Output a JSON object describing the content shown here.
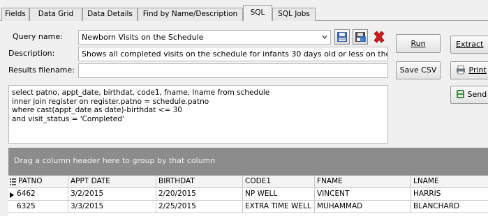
{
  "tabs": [
    {
      "label": "Fields",
      "active": false
    },
    {
      "label": "Data Grid",
      "active": false
    },
    {
      "label": "Data Details",
      "active": false
    },
    {
      "label": "Find by Name/Description",
      "active": false
    },
    {
      "label": "SQL",
      "active": true
    },
    {
      "label": "SQL Jobs",
      "active": false
    }
  ],
  "form": {
    "query_name_label": "Query name:",
    "query_name_value": "Newborn Visits on the Schedule",
    "description_label": "Description:",
    "description_value": "Shows all completed visits on the schedule for infants 30 days old or less on the da",
    "results_filename_label": "Results filename:",
    "results_filename_value": ""
  },
  "sql_text": "select patno, appt_date, birthdat, code1, fname, lname from schedule\ninner join register on register.patno = schedule.patno\nwhere cast(appt_date as date)-birthdat <= 30\nand visit_status = 'Completed'",
  "buttons": {
    "run": "Run",
    "save_csv": "Save CSV",
    "extract": "Extract",
    "print": "Print",
    "send": "Send"
  },
  "grid": {
    "group_hint": "Drag a column header here to group by that column",
    "columns": [
      "PATNO",
      "APPT DATE",
      "BIRTHDAT",
      "CODE1",
      "FNAME",
      "LNAME"
    ],
    "rows": [
      [
        "6462",
        "3/2/2015",
        "2/20/2015",
        "NP WELL",
        "VINCENT",
        "HARRIS"
      ],
      [
        "6325",
        "3/3/2015",
        "2/25/2015",
        "EXTRA TIME WELL",
        "MUHAMMAD",
        "BLANCHARD"
      ]
    ]
  },
  "colors": {
    "delete_icon": "#cc1c1c",
    "group_bar": "#8c8c8c"
  }
}
